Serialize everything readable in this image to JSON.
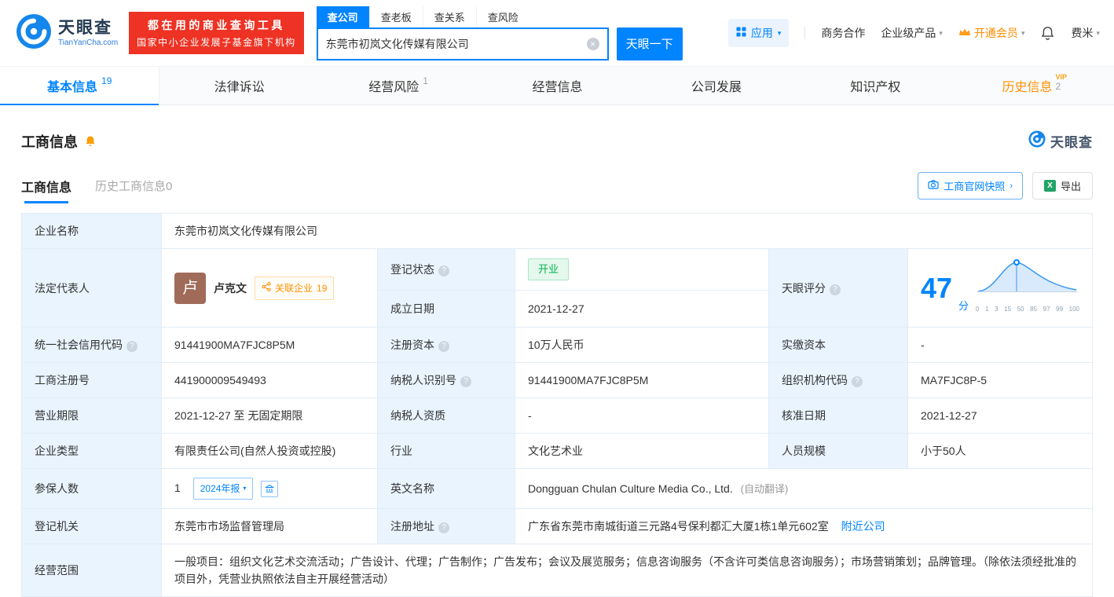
{
  "colors": {
    "accent_blue": "#0084ff",
    "banner_red": "#ee3224",
    "vip_orange": "#ff9000",
    "status_green": "#00b34a",
    "label_bg": "#e9f4fe"
  },
  "header": {
    "brand": "天眼查",
    "brand_domain": "TianYanCha.com",
    "banner_line1": "都在用的商业查询工具",
    "banner_line2": "国家中小企业发展子基金旗下机构",
    "search_tabs": [
      {
        "label": "查公司"
      },
      {
        "label": "查老板"
      },
      {
        "label": "查关系"
      },
      {
        "label": "查风险"
      }
    ],
    "search_value": "东莞市初岚文化传媒有限公司",
    "search_button": "天眼一下",
    "nav_app": "应用",
    "nav_cooperation": "商务合作",
    "nav_enterprise": "企业级产品",
    "nav_vip": "开通会员",
    "nav_user": "费米"
  },
  "tabs": [
    {
      "label": "基本信息",
      "count": "19"
    },
    {
      "label": "法律诉讼",
      "count": ""
    },
    {
      "label": "经营风险",
      "count": "1"
    },
    {
      "label": "经营信息",
      "count": ""
    },
    {
      "label": "公司发展",
      "count": ""
    },
    {
      "label": "知识产权",
      "count": ""
    },
    {
      "label": "历史信息",
      "count": "2",
      "vip": "VIP"
    }
  ],
  "section": {
    "title": "工商信息",
    "watermark_brand": "天眼查",
    "subtab_active": "工商信息",
    "subtab_history": "历史工商信息0",
    "snapshot_button": "工商官网快照",
    "export_button": "导出"
  },
  "table": {
    "company_name_label": "企业名称",
    "company_name": "东莞市初岚文化传媒有限公司",
    "legal_rep_label": "法定代表人",
    "legal_rep_avatar": "卢",
    "legal_rep_name": "卢克文",
    "related_label": "关联企业",
    "related_count": "19",
    "reg_status_label": "登记状态",
    "reg_status": "开业",
    "established_label": "成立日期",
    "established": "2021-12-27",
    "score_label": "天眼评分",
    "score_value": "47",
    "score_unit": "分",
    "score_axis": [
      "0",
      "1",
      "3",
      "15",
      "50",
      "85",
      "97",
      "99",
      "100"
    ],
    "credit_code_label": "统一社会信用代码",
    "credit_code": "91441900MA7FJC8P5M",
    "reg_capital_label": "注册资本",
    "reg_capital": "10万人民币",
    "paid_capital_label": "实缴资本",
    "paid_capital": "-",
    "reg_number_label": "工商注册号",
    "reg_number": "441900009549493",
    "taxpayer_id_label": "纳税人识别号",
    "taxpayer_id": "91441900MA7FJC8P5M",
    "org_code_label": "组织机构代码",
    "org_code": "MA7FJC8P-5",
    "business_term_label": "营业期限",
    "business_term": "2021-12-27 至 无固定期限",
    "taxpayer_quality_label": "纳税人资质",
    "taxpayer_quality": "-",
    "approval_date_label": "核准日期",
    "approval_date": "2021-12-27",
    "company_type_label": "企业类型",
    "company_type": "有限责任公司(自然人投资或控股)",
    "industry_label": "行业",
    "industry": "文化艺术业",
    "staff_size_label": "人员规模",
    "staff_size": "小于50人",
    "insured_label": "参保人数",
    "insured": "1",
    "annual_report_badge": "2024年报",
    "english_name_label": "英文名称",
    "english_name": "Dongguan Chulan Culture Media Co., Ltd.",
    "english_name_note": "(自动翻译)",
    "registry_label": "登记机关",
    "registry": "东莞市市场监督管理局",
    "address_label": "注册地址",
    "address": "广东省东莞市南城街道三元路4号保利都汇大厦1栋1单元602室",
    "nearby_link": "附近公司",
    "business_scope_label": "经营范围",
    "business_scope": "一般项目：组织文化艺术交流活动；广告设计、代理；广告制作；广告发布；会议及展览服务；信息咨询服务（不含许可类信息咨询服务）；市场营销策划；品牌管理。（除依法须经批准的项目外，凭营业执照依法自主开展经营活动）"
  }
}
